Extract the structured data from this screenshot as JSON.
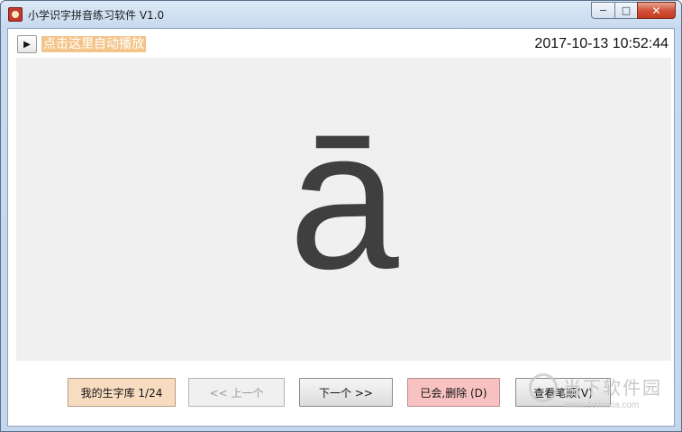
{
  "window": {
    "title": "小学识字拼音练习软件 V1.0",
    "controls": {
      "minimize": "−",
      "maximize": "□",
      "close": "✕"
    }
  },
  "toolbar": {
    "play_icon": "play-icon",
    "play_glyph": "▶",
    "autoplay_label": "点击这里自动播放",
    "datetime": "2017-10-13 10:52:44"
  },
  "display": {
    "pinyin": "ā"
  },
  "buttons": {
    "word_bank": "我的生字库 1/24",
    "prev": "<< 上一个",
    "next": "下一个 >>",
    "known_delete": "已会,删除 (D)",
    "stroke_order": "查看笔顺(V)"
  },
  "watermark": {
    "name": "当下软件园",
    "url": "www.downxia.com"
  },
  "colors": {
    "autoplay_bg": "#f4c58a",
    "word_bank_bg": "#f8dcc0",
    "delete_bg": "#f9c2c2",
    "display_bg": "#f0f0f0",
    "pinyin_color": "#3f3f3f"
  }
}
